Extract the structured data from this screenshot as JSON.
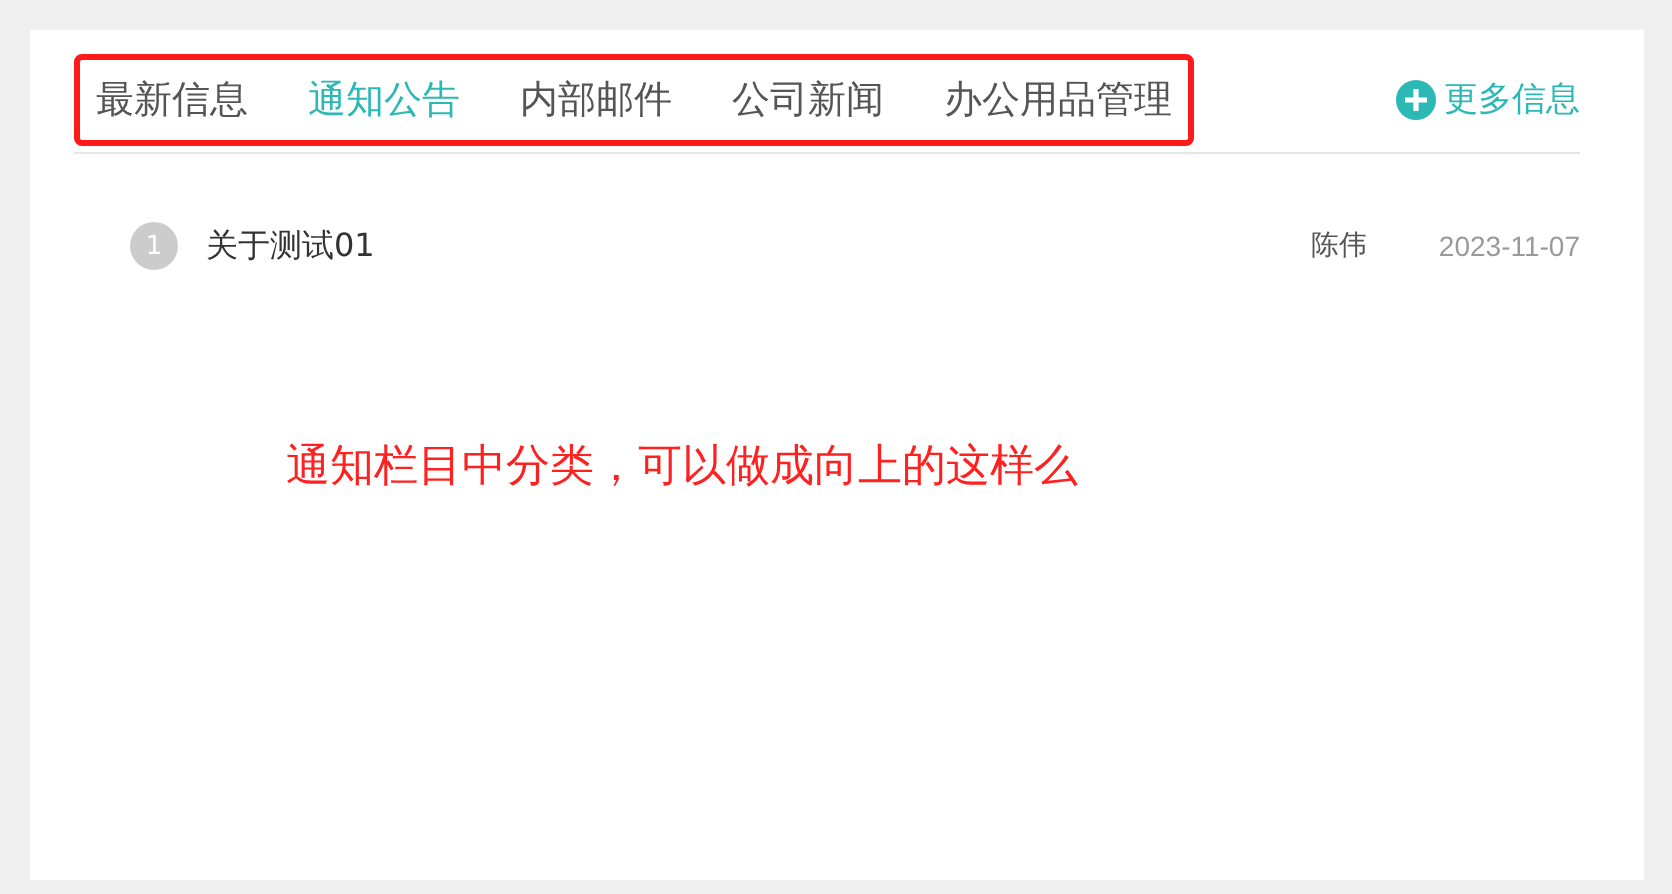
{
  "tabs": [
    {
      "label": "最新信息",
      "selected": false
    },
    {
      "label": "通知公告",
      "selected": true
    },
    {
      "label": "内部邮件",
      "selected": false
    },
    {
      "label": "公司新闻",
      "selected": false
    },
    {
      "label": "办公用品管理",
      "selected": false
    }
  ],
  "more_link": {
    "label": "更多信息"
  },
  "items": [
    {
      "index": "1",
      "title": "关于测试01",
      "author": "陈伟",
      "date": "2023-11-07"
    }
  ],
  "annotation": {
    "text": "通知栏目中分类，可以做成向上的这样么"
  }
}
